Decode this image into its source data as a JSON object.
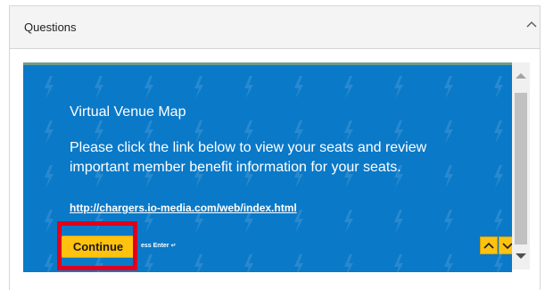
{
  "panel": {
    "title": "Questions",
    "collapse_icon": "chevron-up-icon"
  },
  "content": {
    "heading": "Virtual Venue Map",
    "instructions": "Please click the link below to view your seats and review important member benefit information for your seats.",
    "link_text": "http://chargers.io-media.com/web/index.html",
    "continue_label": "Continue",
    "press_enter": "ess Enter ↵"
  },
  "navigation": {
    "up_icon": "chevron-up-icon",
    "down_icon": "chevron-down-icon"
  },
  "colors": {
    "frame_background": "#0a79c8",
    "accent_button": "#ffc20e",
    "highlight": "#e0001b",
    "panel_header": "#f4f4f4"
  }
}
